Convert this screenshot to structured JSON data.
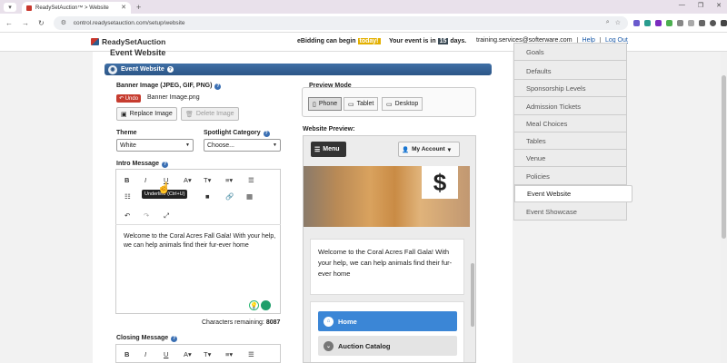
{
  "browser": {
    "tab_title": "ReadySetAuction™ > Website",
    "url": "control.readysetauction.com/setup/website",
    "new_tab": "+"
  },
  "header": {
    "logo_text": "ReadySetAuction",
    "ebidding_prefix": "eBidding can begin",
    "ebidding_value": "today!",
    "event_prefix": "Your event is in",
    "event_days": "15",
    "event_suffix": "days.",
    "email": "training.services@softerware.com",
    "help": "Help",
    "logout": "Log Out"
  },
  "section": {
    "cut_title": "Event Website",
    "title": "Event Website"
  },
  "banner_image": {
    "label": "Banner Image (JPEG, GIF, PNG)",
    "undo": "Undo",
    "filename": "Banner Image.png",
    "replace": "Replace Image",
    "delete": "Delete Image"
  },
  "theme": {
    "label": "Theme",
    "value": "White"
  },
  "spotlight": {
    "label": "Spotlight Category",
    "value": "Choose..."
  },
  "intro": {
    "label": "Intro Message",
    "tooltip": "Underline (Ctrl+U)",
    "text": "Welcome to the Coral Acres Fall Gala! With your help, we can help animals find their fur-ever home",
    "chars_label": "Characters remaining:",
    "chars_value": "8087"
  },
  "closing": {
    "label": "Closing Message"
  },
  "preview_mode": {
    "label": "Preview Mode",
    "phone": "Phone",
    "tablet": "Tablet",
    "desktop": "Desktop",
    "selected": "Phone"
  },
  "website_preview": {
    "label": "Website Preview:",
    "menu": "Menu",
    "account": "My Account",
    "dollar": "$",
    "intro_text": "Welcome to the Coral Acres Fall Gala! With your help, we can help animals find their fur-ever home",
    "home": "Home",
    "catalog": "Auction Catalog"
  },
  "sidebar": {
    "items": [
      {
        "label": "Goals"
      },
      {
        "label": "Defaults"
      },
      {
        "label": "Sponsorship Levels"
      },
      {
        "label": "Admission Tickets"
      },
      {
        "label": "Meal Choices"
      },
      {
        "label": "Tables"
      },
      {
        "label": "Venue"
      },
      {
        "label": "Policies"
      },
      {
        "label": "Event Website"
      },
      {
        "label": "Event Showcase"
      }
    ],
    "active": "Event Website"
  },
  "colors": {
    "section_bar": "#2c5687",
    "undo_red": "#c63c2f",
    "home_blue": "#3b86d6",
    "today_gold": "#e3b000"
  }
}
